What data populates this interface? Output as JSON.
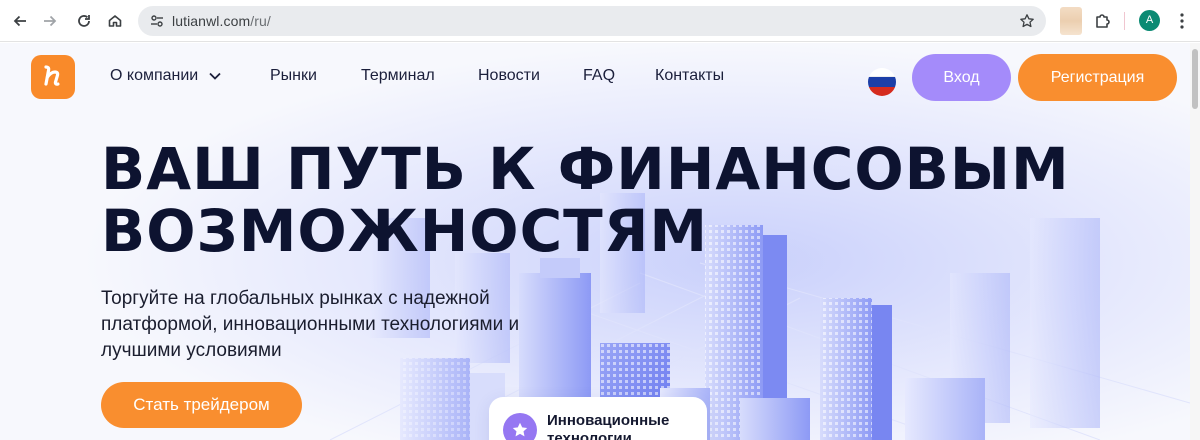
{
  "browser": {
    "url_host": "lutianwl.com",
    "url_path": "/ru/",
    "profile_initial": "A"
  },
  "site": {
    "logo_icon": "brand-logo-icon",
    "nav": [
      {
        "label": "О компании",
        "has_dropdown": true
      },
      {
        "label": "Рынки"
      },
      {
        "label": "Терминал"
      },
      {
        "label": "Новости"
      },
      {
        "label": "FAQ"
      },
      {
        "label": "Контакты"
      }
    ],
    "language_flag": "russia-flag-icon",
    "login_label": "Вход",
    "register_label": "Регистрация"
  },
  "hero": {
    "title_line1": "ВАШ ПУТЬ К ФИНАНСОВЫМ",
    "title_line2": "ВОЗМОЖНОСТЯМ",
    "subtitle": "Торгуйте на глобальных рынках с надежной платформой, инновационными технологиями и лучшими условиями",
    "cta_label": "Стать трейдером"
  },
  "feature_card": {
    "icon": "star-icon",
    "text": "Инновационные технологии"
  },
  "colors": {
    "brand_orange": "#f98e2f",
    "login_purple": "#a48bfa",
    "heading_navy": "#0d1330",
    "illustration_blue": "#6f7ff5"
  }
}
